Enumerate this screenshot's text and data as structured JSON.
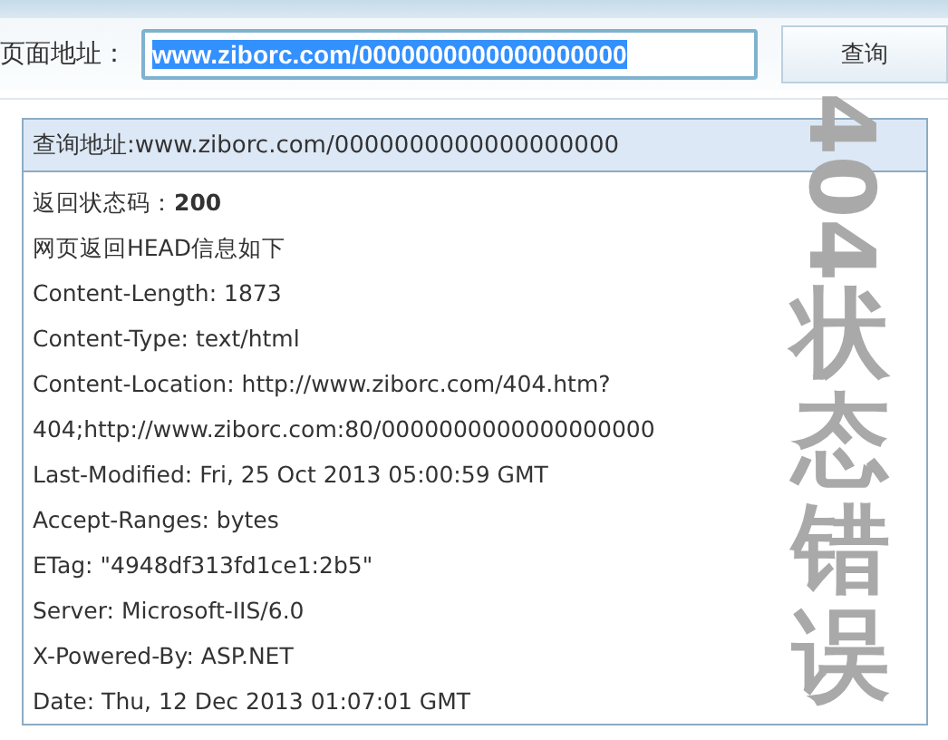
{
  "address_bar": {
    "label": "页面地址：",
    "value": "www.ziborc.com/0000000000000000000",
    "value_selected": true,
    "button": "查询"
  },
  "result": {
    "header": "查询地址:www.ziborc.com/0000000000000000000",
    "status_label": "返回状态码：",
    "status_code": "200",
    "lines": [
      "网页返回HEAD信息如下",
      "Content-Length: 1873",
      "Content-Type: text/html",
      "Content-Location: http://www.ziborc.com/404.htm?",
      "404;http://www.ziborc.com:80/0000000000000000000",
      "Last-Modified: Fri, 25 Oct 2013 05:00:59 GMT",
      "Accept-Ranges: bytes",
      "ETag: \"4948df313fd1ce1:2b5\"",
      "Server: Microsoft-IIS/6.0",
      "X-Powered-By: ASP.NET",
      "Date: Thu, 12 Dec 2013 01:07:01 GMT"
    ]
  },
  "annotation": {
    "number": "404",
    "text": "状态错误"
  }
}
